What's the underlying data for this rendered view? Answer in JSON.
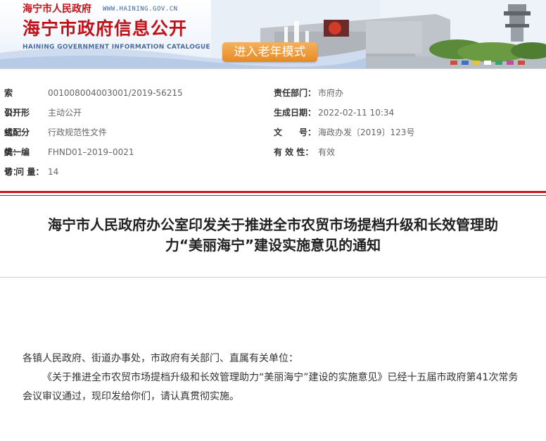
{
  "banner": {
    "org_small": "海宁市人民政府",
    "url": "WWW.HAINING.GOV.CN",
    "site_title": "海宁市政府信息公开",
    "site_title_en": "HAINING GOVERNMENT INFORMATION CATALOGUE",
    "elder_mode_button": "进入老年模式"
  },
  "meta": {
    "index_label": "索　　引：",
    "index_value": "001008004003001/2019-56215",
    "dept_label": "责任部门：",
    "dept_value": "市府办",
    "disclosure_label": "公开形式：",
    "disclosure_value": "主动公开",
    "date_label": "生成日期：",
    "date_value": "2022-02-11 10:34",
    "category_label": "组配分类：",
    "category_value": "行政规范性文件",
    "docno_label": "文　　号：",
    "docno_value": "海政办发〔2019〕123号",
    "unified_label": "统一编号：",
    "unified_value": "FHND01–2019–0021",
    "validity_label": "有 效 性：",
    "validity_value": "有效",
    "visits_label": "访 问 量：",
    "visits_value": "14"
  },
  "article": {
    "title_line1": "海宁市人民政府办公室印发关于推进全市农贸市场提档升级和长效管理助",
    "title_line2": "力“美丽海宁”建设实施意见的通知",
    "salutation": "各镇人民政府、街道办事处，市政府有关部门、直属有关单位：",
    "paragraph1": "《关于推进全市农贸市场提档升级和长效管理助力“美丽海宁”建设的实施意见》已经十五届市政府第41次常务会议审议通过，现印发给你们，请认真贯彻实施。"
  }
}
